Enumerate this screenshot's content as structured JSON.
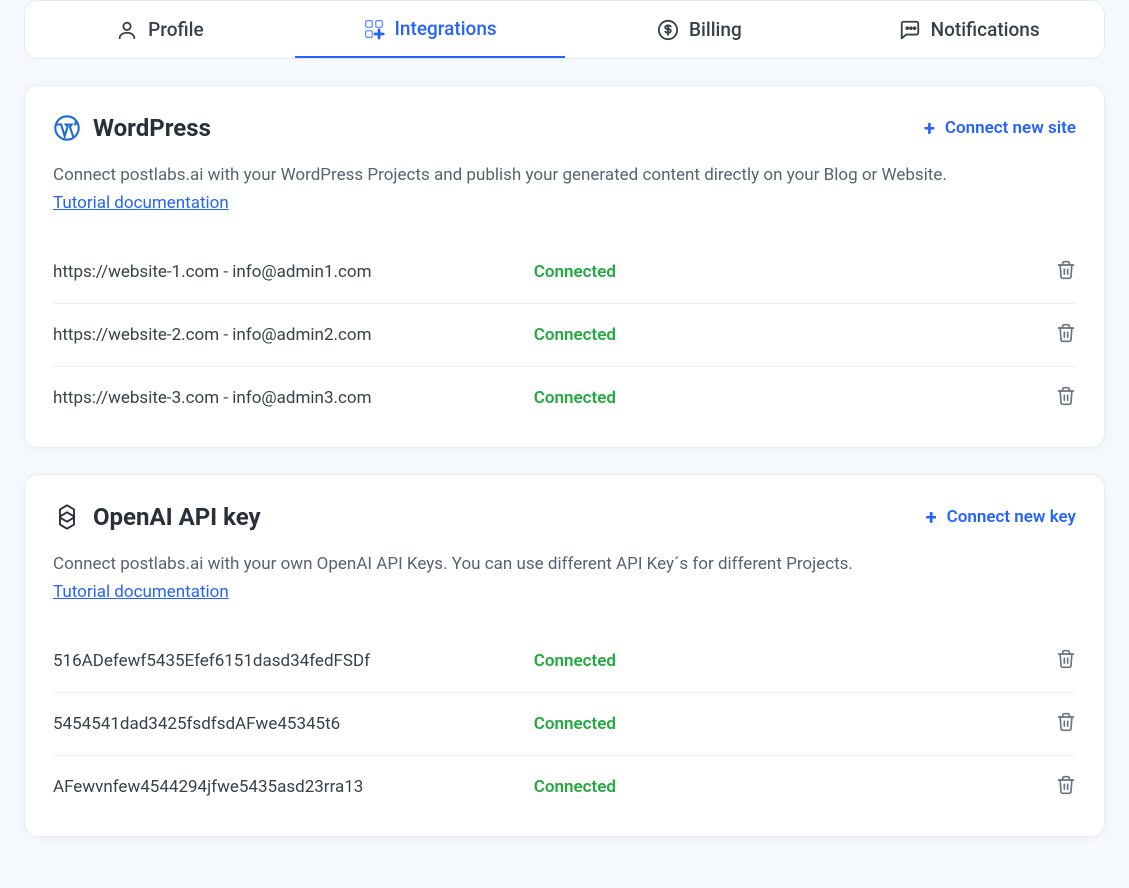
{
  "tabs": {
    "profile": "Profile",
    "integrations": "Integrations",
    "billing": "Billing",
    "notifications": "Notifications"
  },
  "wordpress": {
    "title": "WordPress",
    "connect_label": "Connect new site",
    "description": "Connect postlabs.ai with your WordPress Projects and publish your generated content directly on your Blog or Website.",
    "tutorial_label": "Tutorial documentation",
    "sites": [
      {
        "label": "https://website-1.com - info@admin1.com",
        "status": "Connected"
      },
      {
        "label": "https://website-2.com - info@admin2.com",
        "status": "Connected"
      },
      {
        "label": "https://website-3.com - info@admin3.com",
        "status": "Connected"
      }
    ]
  },
  "openai": {
    "title": "OpenAI API key",
    "connect_label": "Connect new key",
    "description": "Connect postlabs.ai with your own OpenAI API Keys. You can use different API Key´s for different Projects.",
    "tutorial_label": "Tutorial documentation",
    "keys": [
      {
        "label": "516ADefewf5435Efef6151dasd34fedFSDf",
        "status": "Connected"
      },
      {
        "label": "5454541dad3425fsdfsdAFwe45345t6",
        "status": "Connected"
      },
      {
        "label": "AFewvnfew4544294jfwe5435asd23rra13",
        "status": "Connected"
      }
    ]
  }
}
